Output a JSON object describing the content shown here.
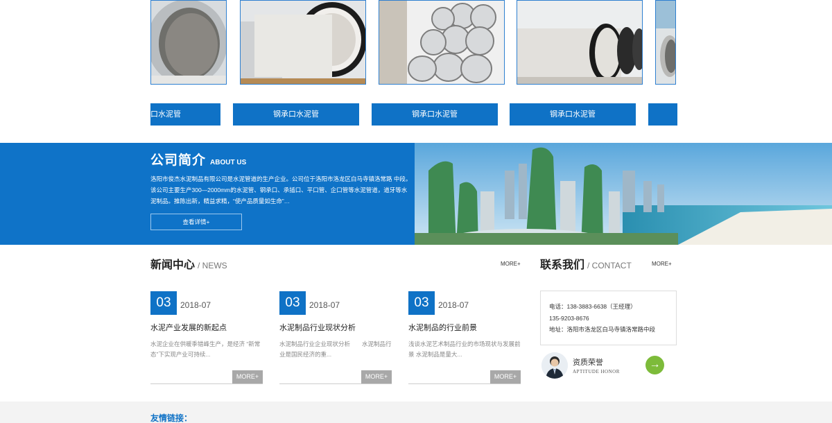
{
  "products": [
    {
      "label": "口水泥管"
    },
    {
      "label": "钢承口水泥管"
    },
    {
      "label": "钢承口水泥管"
    },
    {
      "label": "钢承口水泥管"
    },
    {
      "label": ""
    }
  ],
  "about": {
    "title": "公司简介",
    "subtitle": "ABOUT US",
    "text": "洛阳市俊杰水泥制品有限公司是水泥管道的生产企业。公司位于洛阳市洛龙区白马寺镇洛常路 中段。 该公司主要生产300—2000mm的水泥管、钢承口、承插口、平口管、企口管等水泥管道，道牙等水泥制品。推陈出新，精益求精，“使产品质量如生命”…",
    "button": "查看详情+"
  },
  "news": {
    "title": "新闻中心",
    "title_en": "/ NEWS",
    "more": "MORE+",
    "items": [
      {
        "day": "03",
        "month": "2018-07",
        "title": "水泥产业发展的新起点",
        "summary": "水泥企业在供暖季错峰生产，是经济 “新常态”下实现产业可持续...",
        "more": "MORE+"
      },
      {
        "day": "03",
        "month": "2018-07",
        "title": "水泥制品行业现状分析",
        "summary": "水泥制品行业企业现状分析　　水泥制品行业是国民经济的重...",
        "more": "MORE+"
      },
      {
        "day": "03",
        "month": "2018-07",
        "title": "水泥制品的行业前景",
        "summary": "浅谈水泥艺术制品行业的市场现状与发展前景 水泥制品是量大...",
        "more": "MORE+"
      }
    ]
  },
  "contact": {
    "title": "联系我们",
    "title_en": "/ CONTACT",
    "more": "MORE+",
    "phone1": "电话：138-3883-6638（王经理）",
    "phone2": "135-9203-8676",
    "address": "地址：洛阳市洛龙区白马寺镇洛常路中段"
  },
  "honor": {
    "title": "资质荣誉",
    "subtitle": "APTITUDE HONOR",
    "arrow": "→"
  },
  "links": {
    "title": "友情链接："
  },
  "colors": {
    "brand_blue": "#0f72c6",
    "accent_green": "#7dbb3a",
    "more_grey": "#a8a8a8"
  }
}
